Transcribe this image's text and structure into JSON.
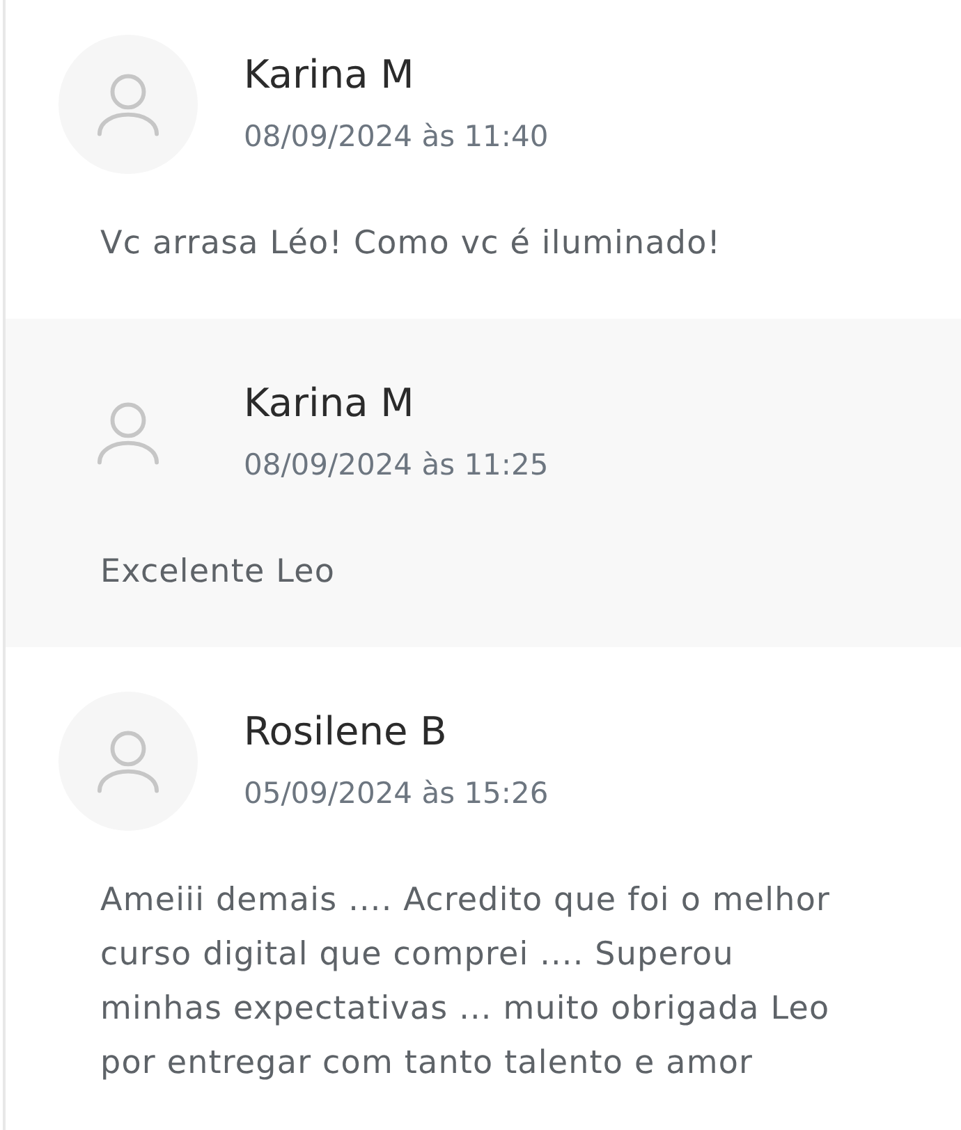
{
  "comments": [
    {
      "author": "Karina M",
      "date": "08/09/2024 às 11:40",
      "text": "Vc arrasa Léo! Como vc é iluminado!"
    },
    {
      "author": "Karina M",
      "date": "08/09/2024 às 11:25",
      "text": "Excelente Leo"
    },
    {
      "author": "Rosilene B",
      "date": "05/09/2024 às 15:26",
      "text": "Ameiii demais .... Acredito que foi o melhor curso digital que comprei .... Superou minhas expectativas ... muito obrigada Leo por entregar com tanto talento e amor"
    }
  ]
}
